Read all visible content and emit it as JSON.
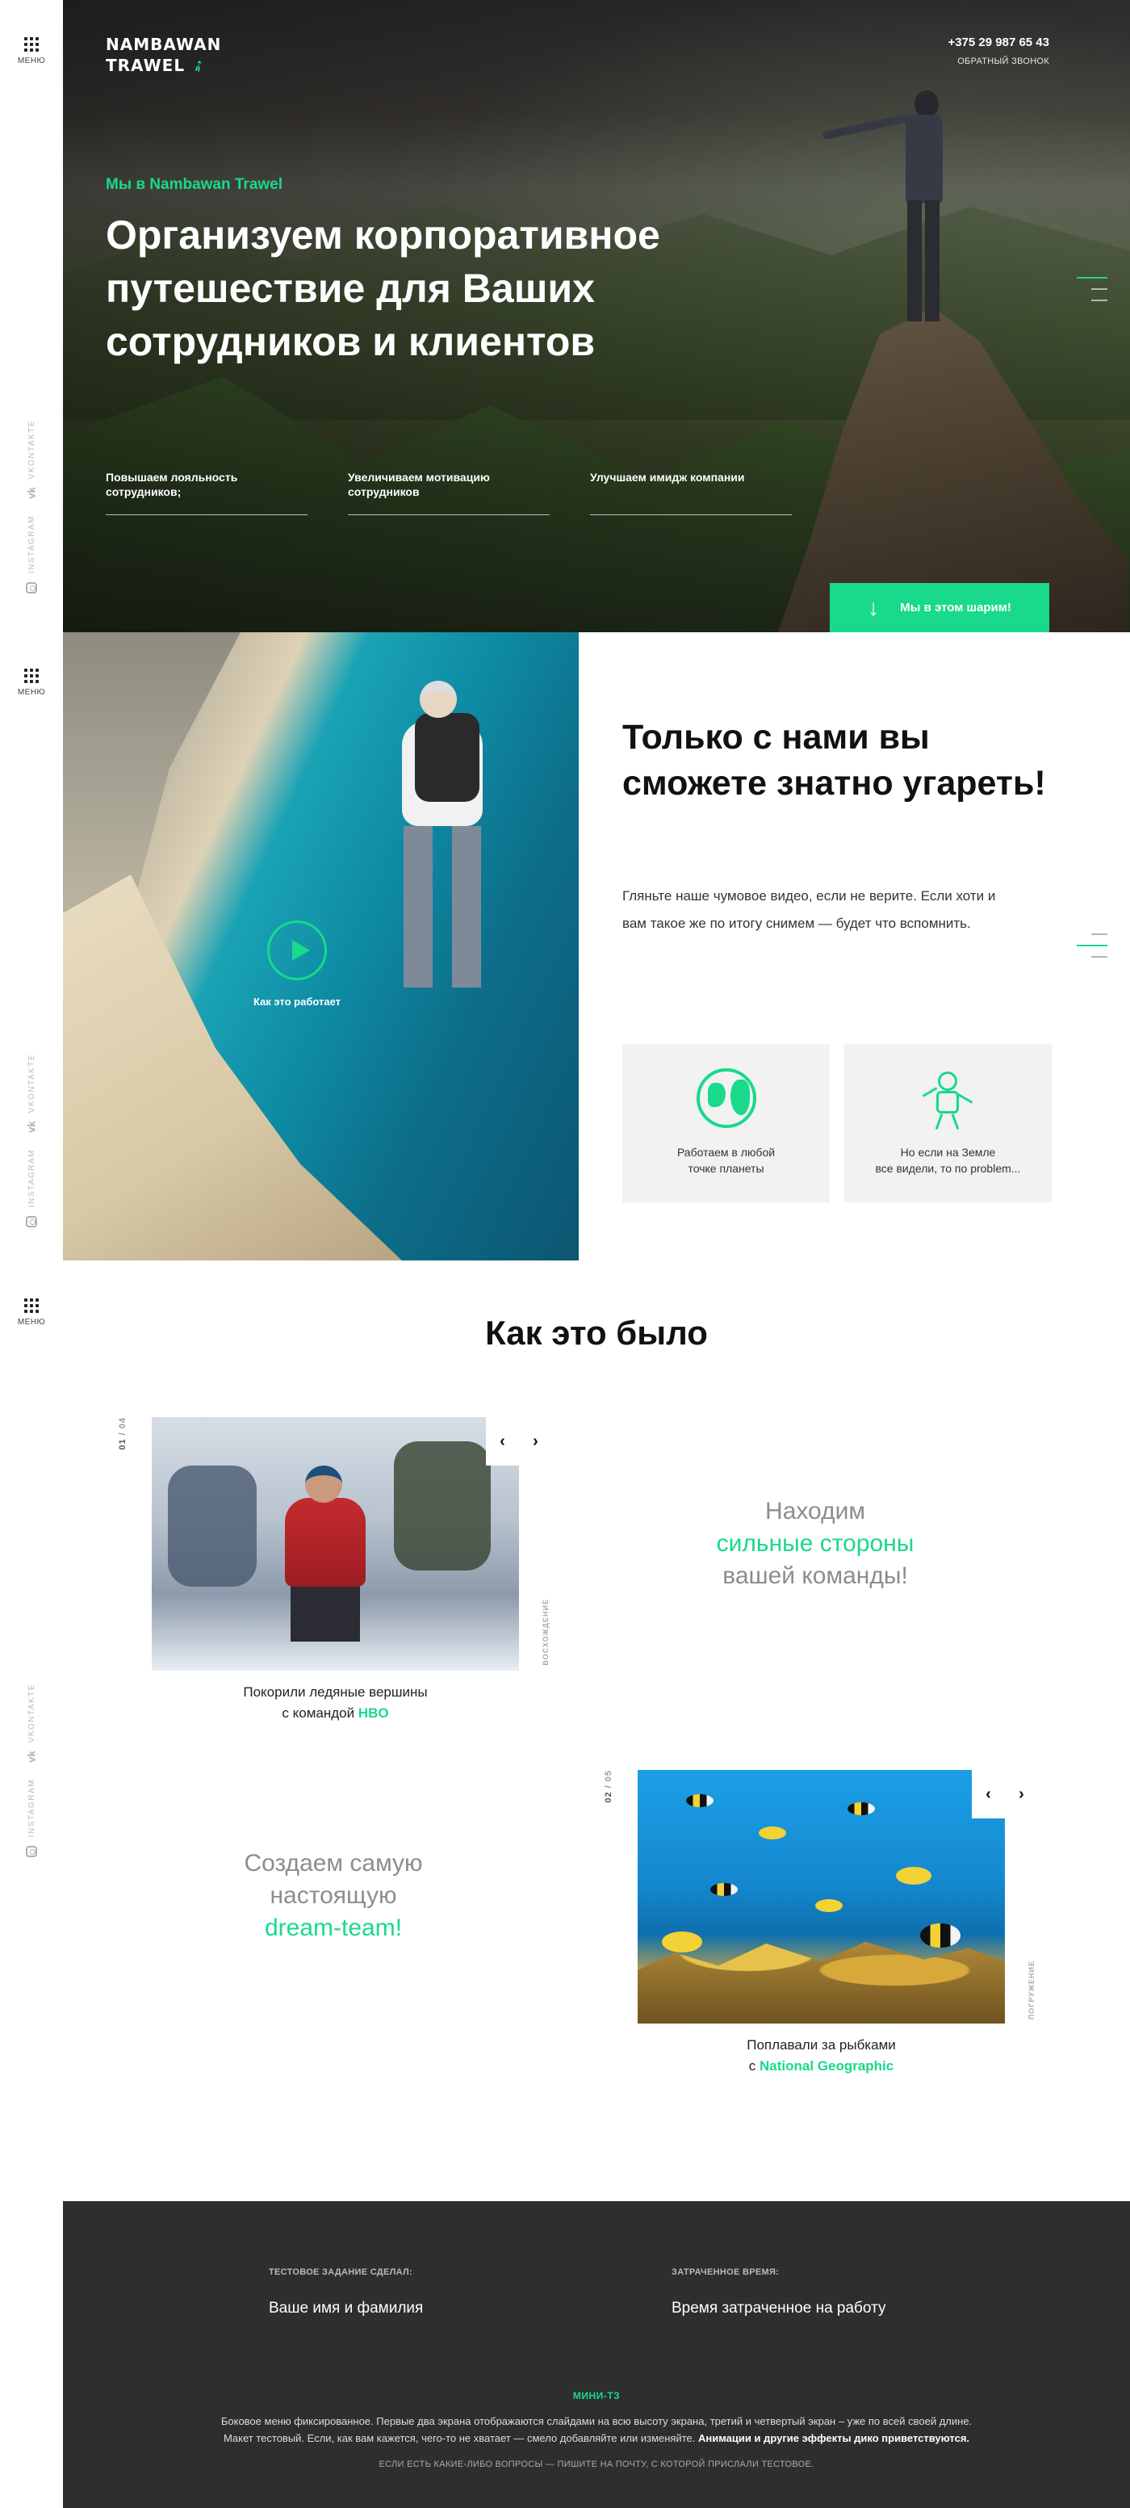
{
  "sidebar": {
    "menu_label": "МЕНЮ",
    "vk_label": "VKONTAKTE",
    "vk_icon": "vk",
    "ig_label": "INSTAGRAM"
  },
  "header": {
    "logo_line1": "NAMBAWAN",
    "logo_line2": "TRAWEL",
    "phone": "+375 29 987 65 43",
    "callback": "ОБРАТНЫЙ ЗВОНОК"
  },
  "hero": {
    "eyebrow": "Мы в Nambawan Trawel",
    "title": "Организуем корпоративное путешествие  для Ваших сотрудников и клиентов",
    "features": [
      {
        "text": "Повышаем лояльность сотрудников;"
      },
      {
        "text": "Увеличиваем мотивацию сотрудников"
      },
      {
        "text": "Улучшаем имидж компании"
      }
    ],
    "cta": "Мы в этом шарим!",
    "cta_icon": "↓"
  },
  "about": {
    "play_label": "Как это работает",
    "title": "Только с нами вы сможете знатно угареть!",
    "text": "Гляньте наше чумовое видео, если не верите. Если хоти и вам такое же по итогу снимем — будет что вспомнить.",
    "cards": [
      {
        "icon": "globe-icon",
        "line1": "Работаем в любой",
        "line2": "точке планеты"
      },
      {
        "icon": "astronaut-icon",
        "line1": "Но если на Земле",
        "line2": "все видели, то по problem..."
      }
    ]
  },
  "cases": {
    "title": "Как это было",
    "items": [
      {
        "current": "01",
        "total": "04",
        "tag": "ВОСХОЖДЕНИЕ",
        "caption_line1": "Покорили ледяные вершины",
        "caption_prefix": "с командой ",
        "caption_brand": "HBO"
      },
      {
        "current": "02",
        "total": "05",
        "tag": "ПОГРУЖЕНИЕ",
        "caption_line1": "Поплавали за рыбками",
        "caption_prefix": "с ",
        "caption_brand": "National Geographic"
      }
    ],
    "quote1": {
      "line1": "Находим",
      "highlight": "сильные стороны",
      "line3": "вашей команды!"
    },
    "quote2": {
      "line1": "Создаем самую",
      "line2": "настоящую",
      "highlight": "dream-team!"
    },
    "arrow_prev": "‹",
    "arrow_next": "›"
  },
  "footer": {
    "author_label": "ТЕСТОВОЕ ЗАДАНИЕ СДЕЛАЛ:",
    "author_value": "Ваше имя и фамилия",
    "time_label": "ЗАТРАЧЕННОЕ ВРЕМЯ:",
    "time_value": "Время затраченное на работу",
    "mini": "МИНИ-ТЗ",
    "desc_line1": "Боковое меню фиксированное. Первые два экрана отображаются слайдами на всю высоту экрана, третий и четвертый экран – уже по всей своей длине.",
    "desc_line2_plain": "Макет тестовый. Если, как вам кажется, чего-то не хватает — смело добавляйте или изменяйте. ",
    "desc_line2_bold": "Анимации и другие эффекты дико приветствуются.",
    "bottom": "ЕСЛИ ЕСТЬ КАКИЕ-ЛИБО ВОПРОСЫ  — ПИШИТЕ НА ПОЧТУ, С КОТОРОЙ ПРИСЛАЛИ ТЕСТОВОЕ."
  },
  "colors": {
    "accent": "#19d98b",
    "footer_bg": "#2e2e2e",
    "card_bg": "#f2f2f2"
  }
}
